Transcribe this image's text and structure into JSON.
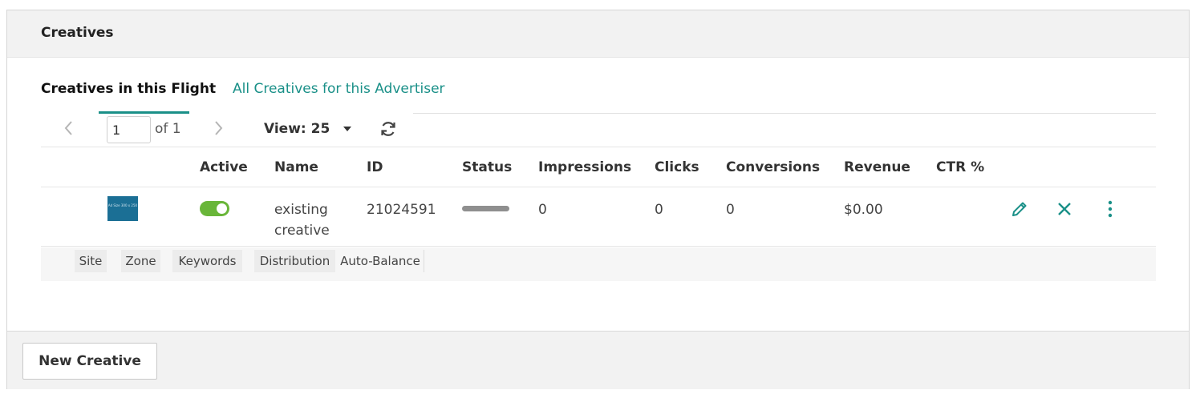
{
  "panel": {
    "title": "Creatives"
  },
  "tabs": {
    "active": "Creatives in this Flight",
    "other": "All Creatives for this Advertiser"
  },
  "pager": {
    "page_value": "1",
    "of_label": "of 1",
    "view_label": "View: 25"
  },
  "table": {
    "headers": [
      "Active",
      "Name",
      "ID",
      "Status",
      "Impressions",
      "Clicks",
      "Conversions",
      "Revenue",
      "CTR %"
    ],
    "rows": [
      {
        "thumb_text": "Ad Size 300 x 250",
        "active": true,
        "name": "existing creative",
        "id": "21024591",
        "impressions": "0",
        "clicks": "0",
        "conversions": "0",
        "revenue": "$0.00",
        "ctr": ""
      }
    ]
  },
  "sub_tabs": [
    "Site",
    "Zone",
    "Keywords",
    "Distribution",
    "Auto-Balance"
  ],
  "footer": {
    "new_button": "New Creative"
  },
  "colors": {
    "accent": "#1a9088",
    "toggle_on": "#69b639",
    "thumb_bg": "#1b6f95"
  },
  "icons": [
    "chevron-left-icon",
    "chevron-right-icon",
    "caret-down-icon",
    "refresh-icon",
    "pencil-icon",
    "close-icon",
    "more-vertical-icon"
  ]
}
